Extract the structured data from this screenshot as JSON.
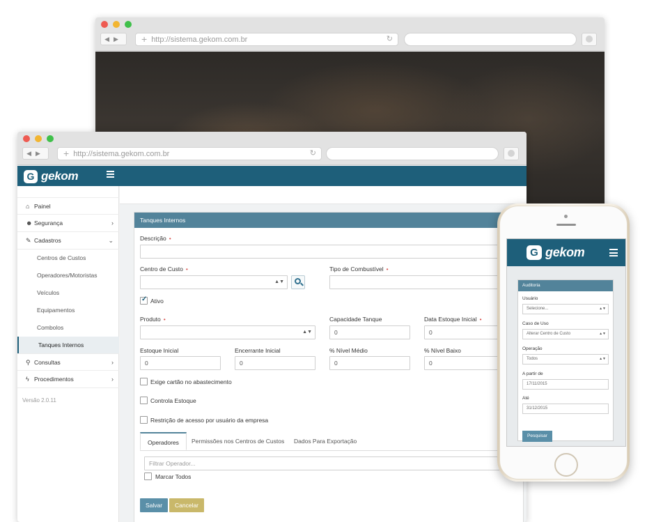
{
  "back_browser": {
    "url": "http://sistema.gekom.com.br"
  },
  "front_browser": {
    "url": "http://sistema.gekom.com.br",
    "app": {
      "logo_mark": "G",
      "logo_text": "gekom",
      "sidebar": {
        "items": [
          {
            "label": "Painel",
            "icon": "home-icon"
          },
          {
            "label": "Segurança",
            "icon": "users-icon"
          },
          {
            "label": "Cadastros",
            "icon": "edit-icon"
          }
        ],
        "sub_items": [
          "Centros de Custos",
          "Operadores/Motoristas",
          "Veículos",
          "Equipamentos",
          "Combolos",
          "Tanques Internos"
        ],
        "items_after": [
          {
            "label": "Consultas",
            "icon": "search-icon"
          },
          {
            "label": "Procedimentos",
            "icon": "bolt-icon"
          }
        ],
        "version": "Versão 2.0.11"
      },
      "form": {
        "title": "Tanques Internos",
        "descricao_label": "Descrição",
        "centro_custo_label": "Centro de Custo",
        "tipo_combustivel_label": "Tipo de Combustível",
        "ativo_label": "Ativo",
        "produto_label": "Produto",
        "capacidade_label": "Capacidade Tanque",
        "capacidade_value": "0",
        "data_estoque_label": "Data Estoque Inicial",
        "data_estoque_value": "0",
        "estoque_inicial_label": "Estoque Inicial",
        "estoque_inicial_value": "0",
        "encerrante_label": "Encerrante Inicial",
        "encerrante_value": "0",
        "nivel_medio_label": "% Nível Médio",
        "nivel_medio_value": "0",
        "nivel_baixo_label": "% Nível Baixo",
        "nivel_baixo_value": "0",
        "exige_cartao_label": "Exige cartão no abastecimento",
        "controla_estoque_label": "Controla Estoque",
        "restricao_label": "Restrição de acesso por usuário da empresa",
        "tabs": [
          "Operadores",
          "Permissões nos Centros de Custos",
          "Dados Para Exportação"
        ],
        "filter_placeholder": "Filtrar Operador...",
        "marcar_todos_label": "Marcar Todos",
        "save_label": "Salvar",
        "cancel_label": "Cancelar"
      }
    }
  },
  "phone": {
    "logo_mark": "G",
    "logo_text": "gekom",
    "panel_title": "Auditoria",
    "usuario_label": "Usuário",
    "usuario_value": "Selecione...",
    "caso_uso_label": "Caso de Uso",
    "caso_uso_value": "Alterar Centro de Custo",
    "operacao_label": "Operação",
    "operacao_value": "Todos",
    "a_partir_label": "A partir de",
    "a_partir_value": "17/11/2015",
    "ate_label": "Até",
    "ate_value": "31/12/2015",
    "pesquisar_label": "Pesquisar"
  },
  "colors": {
    "header": "#1e5f7a",
    "panel_head": "#52839a",
    "save": "#5a8fa8",
    "cancel": "#c9b86a"
  }
}
